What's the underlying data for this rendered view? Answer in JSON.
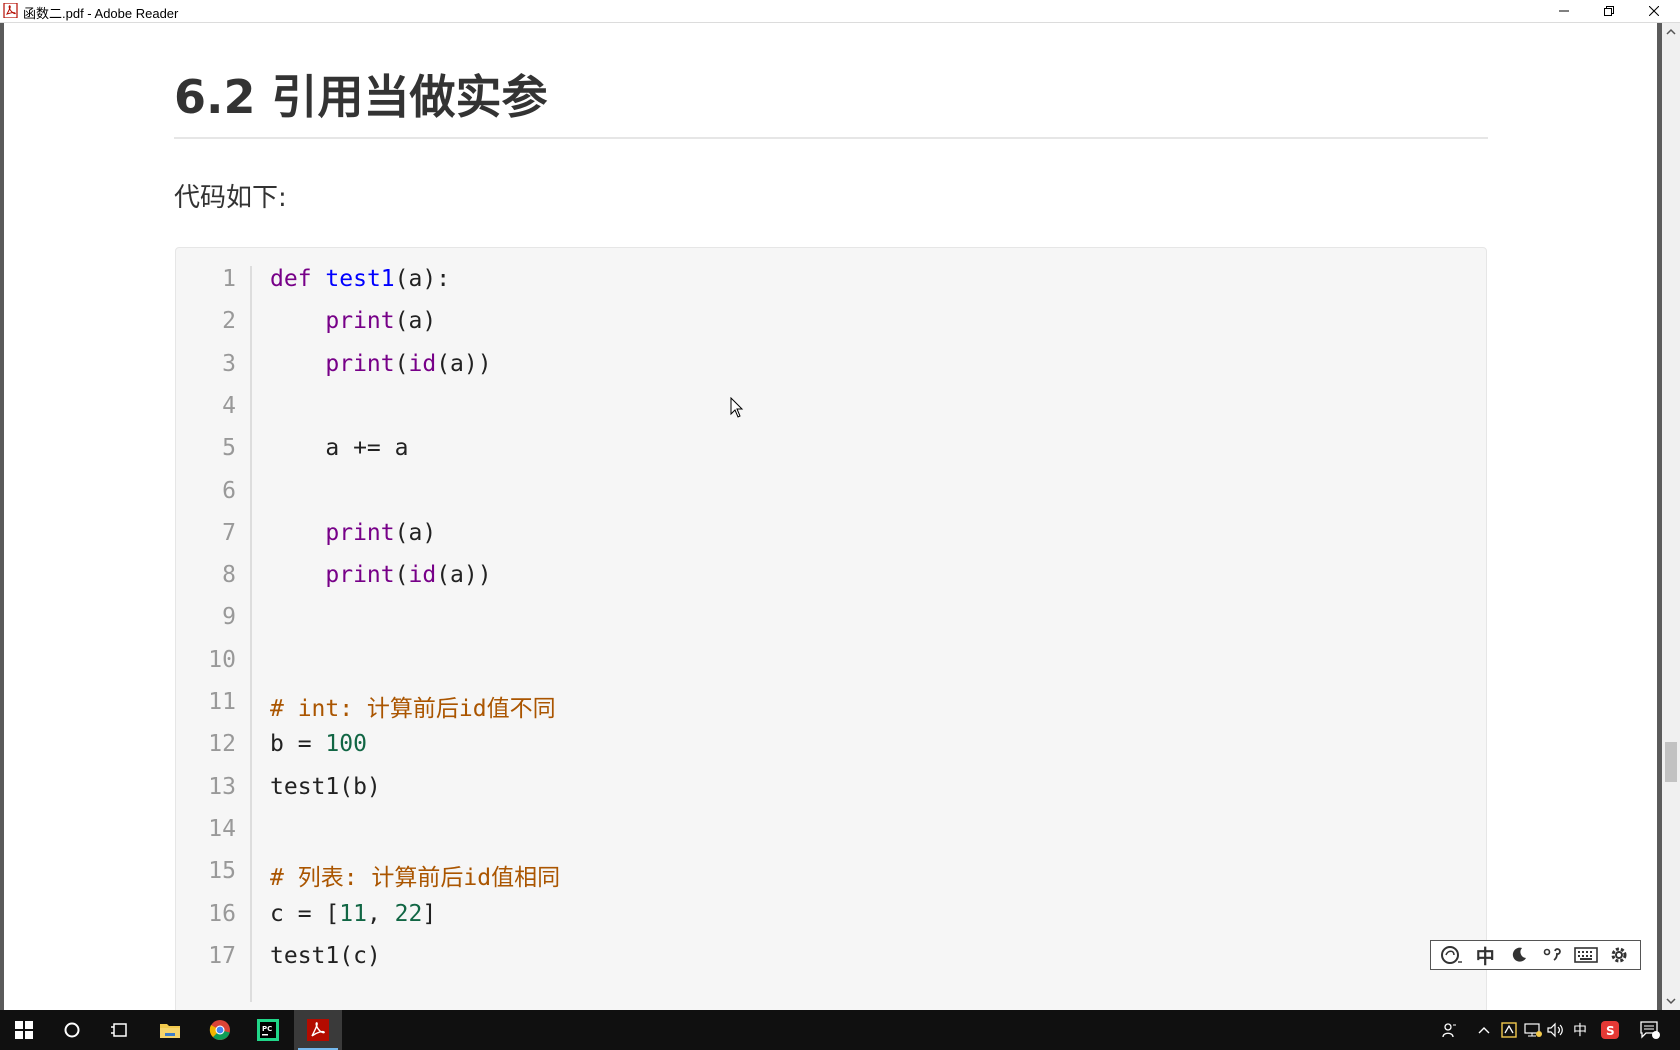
{
  "window": {
    "title": "函数二.pdf - Adobe Reader"
  },
  "document": {
    "heading": "6.2 引用当做实参",
    "intro": "代码如下:",
    "code_lines": [
      {
        "number": "1",
        "tokens": [
          {
            "t": "def",
            "c": "kw"
          },
          {
            "t": " ",
            "c": "plain"
          },
          {
            "t": "test1",
            "c": "def"
          },
          {
            "t": "(a):",
            "c": "plain"
          }
        ]
      },
      {
        "number": "2",
        "tokens": [
          {
            "t": "    ",
            "c": "plain"
          },
          {
            "t": "print",
            "c": "kw"
          },
          {
            "t": "(a)",
            "c": "plain"
          }
        ]
      },
      {
        "number": "3",
        "tokens": [
          {
            "t": "    ",
            "c": "plain"
          },
          {
            "t": "print",
            "c": "kw"
          },
          {
            "t": "(",
            "c": "plain"
          },
          {
            "t": "id",
            "c": "kw"
          },
          {
            "t": "(a))",
            "c": "plain"
          }
        ]
      },
      {
        "number": "4",
        "tokens": []
      },
      {
        "number": "5",
        "tokens": [
          {
            "t": "    a += a",
            "c": "plain"
          }
        ]
      },
      {
        "number": "6",
        "tokens": []
      },
      {
        "number": "7",
        "tokens": [
          {
            "t": "    ",
            "c": "plain"
          },
          {
            "t": "print",
            "c": "kw"
          },
          {
            "t": "(a)",
            "c": "plain"
          }
        ]
      },
      {
        "number": "8",
        "tokens": [
          {
            "t": "    ",
            "c": "plain"
          },
          {
            "t": "print",
            "c": "kw"
          },
          {
            "t": "(",
            "c": "plain"
          },
          {
            "t": "id",
            "c": "kw"
          },
          {
            "t": "(a))",
            "c": "plain"
          }
        ]
      },
      {
        "number": "9",
        "tokens": []
      },
      {
        "number": "10",
        "tokens": []
      },
      {
        "number": "11",
        "tokens": [
          {
            "t": "# int: 计算前后id值不同",
            "c": "comment"
          }
        ]
      },
      {
        "number": "12",
        "tokens": [
          {
            "t": "b = ",
            "c": "plain"
          },
          {
            "t": "100",
            "c": "num"
          }
        ]
      },
      {
        "number": "13",
        "tokens": [
          {
            "t": "test1(b)",
            "c": "plain"
          }
        ]
      },
      {
        "number": "14",
        "tokens": []
      },
      {
        "number": "15",
        "tokens": [
          {
            "t": "# 列表: 计算前后id值相同",
            "c": "comment"
          }
        ]
      },
      {
        "number": "16",
        "tokens": [
          {
            "t": "c = [",
            "c": "plain"
          },
          {
            "t": "11",
            "c": "num"
          },
          {
            "t": ", ",
            "c": "plain"
          },
          {
            "t": "22",
            "c": "num"
          },
          {
            "t": "]",
            "c": "plain"
          }
        ]
      },
      {
        "number": "17",
        "tokens": [
          {
            "t": "test1(c)",
            "c": "plain"
          }
        ]
      }
    ]
  },
  "ime_toolbar": {
    "items": [
      {
        "name": "ime-logo-icon",
        "label": ""
      },
      {
        "name": "ime-chinese-mode",
        "label": "中"
      },
      {
        "name": "ime-moon-icon",
        "label": ""
      },
      {
        "name": "ime-punctuation-icon",
        "label": ""
      },
      {
        "name": "ime-keyboard-icon",
        "label": ""
      },
      {
        "name": "ime-settings-icon",
        "label": ""
      }
    ]
  },
  "taskbar": {
    "apps": [
      {
        "name": "start-button",
        "icon": "windows-icon",
        "active": false
      },
      {
        "name": "search-button",
        "icon": "search-circle-icon",
        "active": false
      },
      {
        "name": "task-view-button",
        "icon": "task-view-icon",
        "active": false
      },
      {
        "name": "file-explorer-button",
        "icon": "folder-icon",
        "active": false
      },
      {
        "name": "chrome-button",
        "icon": "chrome-icon",
        "active": false
      },
      {
        "name": "pycharm-button",
        "icon": "pycharm-icon",
        "active": false
      },
      {
        "name": "adobe-reader-button",
        "icon": "adobe-reader-icon",
        "active": true
      }
    ],
    "tray": {
      "input_language": "中"
    }
  },
  "colors": {
    "keyword": "#770088",
    "function_name": "#0000ff",
    "number": "#116644",
    "comment": "#aa5500",
    "code_background": "#f6f6f6",
    "taskbar": "#101010"
  }
}
